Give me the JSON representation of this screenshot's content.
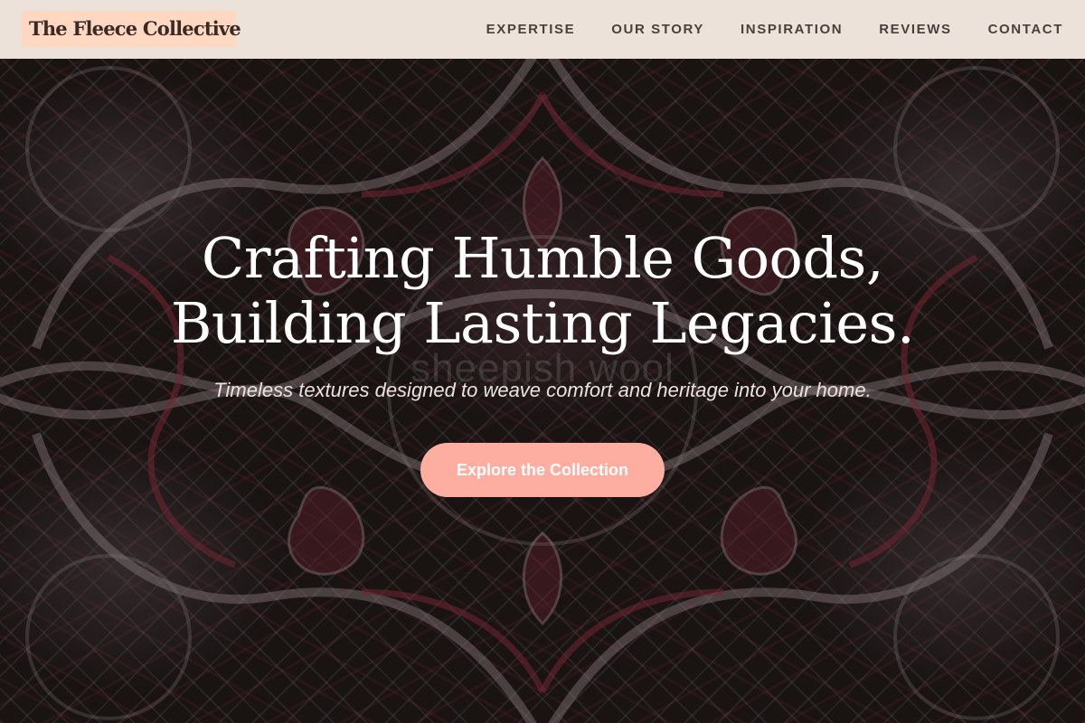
{
  "header": {
    "logo_text": "The Fleece Collective",
    "nav": [
      {
        "label": "EXPERTISE"
      },
      {
        "label": "OUR STORY"
      },
      {
        "label": "INSPIRATION"
      },
      {
        "label": "REVIEWS"
      },
      {
        "label": "CONTACT"
      }
    ]
  },
  "hero": {
    "title_line1": "Crafting Humble Goods,",
    "title_line2": "Building Lasting Legacies.",
    "watermark": "sheepish wool",
    "subtitle": "Timeless textures designed to weave comfort and heritage into your home.",
    "cta_label": "Explore the Collection"
  },
  "colors": {
    "header_bg": "#ede2d9",
    "logo_bg": "#ffd8c2",
    "nav_text": "#4a3f3c",
    "cta_bg": "#fdaea1",
    "hero_bg": "#1b1514"
  },
  "icons": {
    "hero_background": "paisley-carpet-pattern"
  }
}
